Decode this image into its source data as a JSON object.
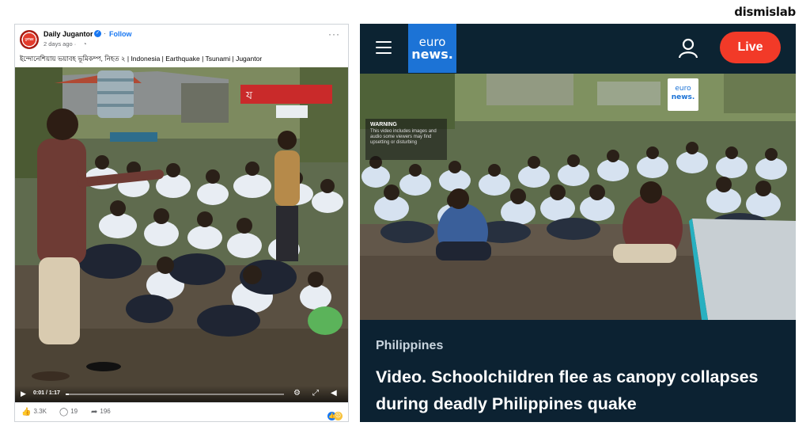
{
  "watermark": "dismislab",
  "facebook_post": {
    "page_name": "Daily Jugantor",
    "follow_label": "Follow",
    "posted_time": "2 days ago",
    "avatar_label": "যুগান্তর",
    "caption": "ইন্দোনেশিয়ায় ভয়াবহ ভূমিকম্প, নিহত ২ | Indonesia | Earthquake | Tsunami | Jugantor",
    "video": {
      "timecode": "0:01 / 1:17",
      "progress_fraction": 0.013,
      "icons": [
        "play-icon",
        "settings-icon",
        "fullscreen-icon",
        "volume-icon"
      ]
    },
    "stats": {
      "likes": "3.3K",
      "comments": "19",
      "shares": "196"
    },
    "colors": {
      "accent": "#1877f2",
      "logo_red": "#e23b2c"
    }
  },
  "euronews": {
    "logo_line1": "euro",
    "logo_line2": "news.",
    "live_label": "Live",
    "warning_title": "WARNING",
    "warning_text": "This video includes images and audio some viewers may find upsetting or disturbing",
    "kicker": "Philippines",
    "headline": "Video. Schoolchildren flee as canopy collapses during deadly Philippines quake",
    "colors": {
      "background": "#0c2232",
      "logo_blue": "#1c73d6",
      "live_red": "#f23a28"
    }
  }
}
